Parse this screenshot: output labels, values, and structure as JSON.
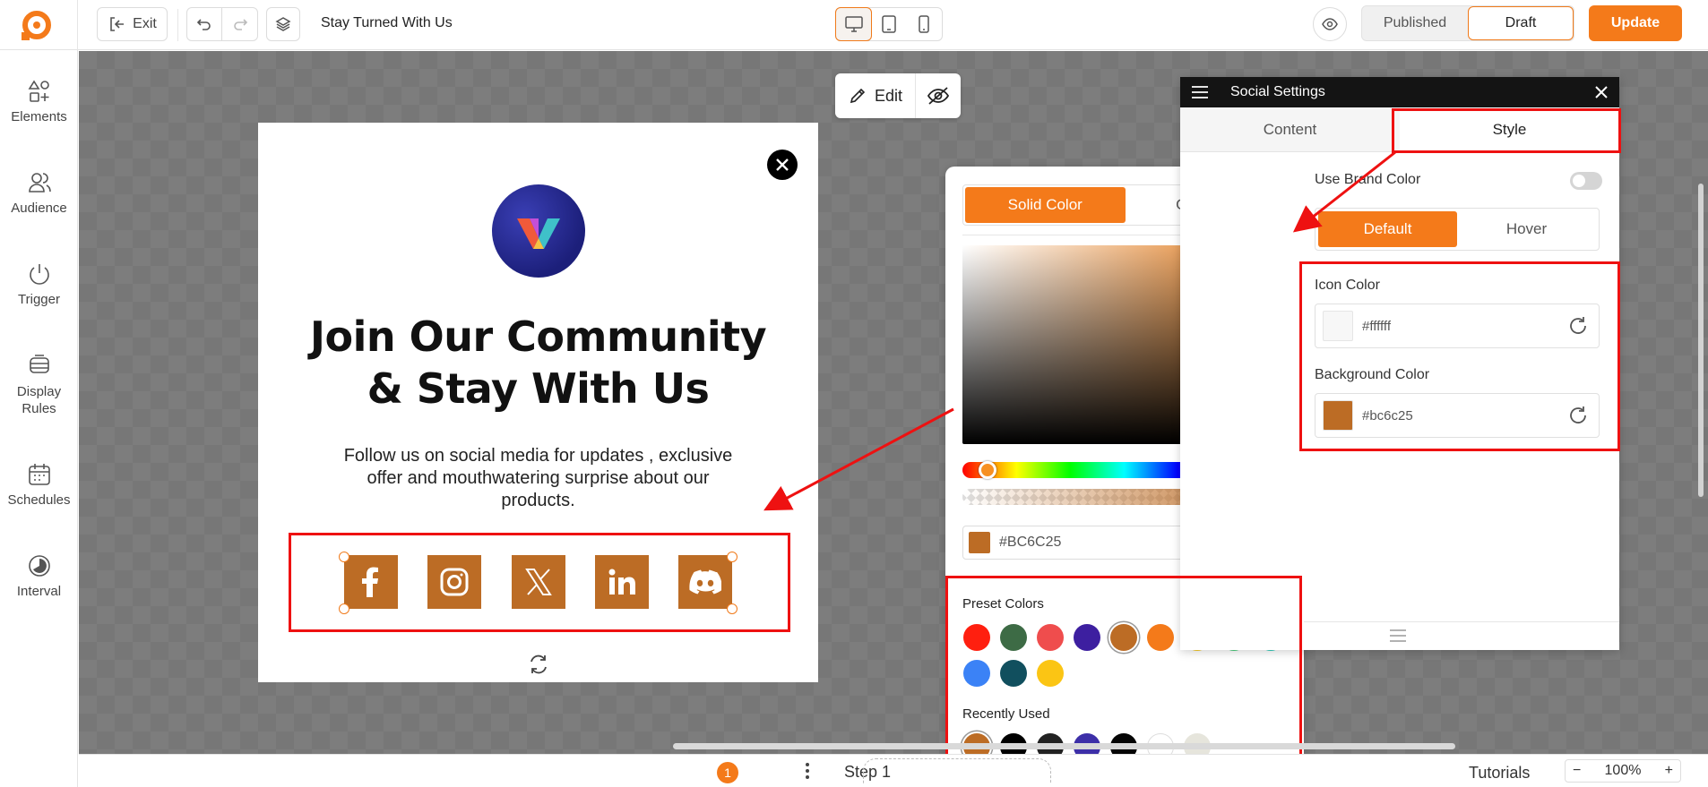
{
  "topbar": {
    "exit_label": "Exit",
    "document_title": "Stay Turned With Us",
    "published_label": "Published",
    "draft_label": "Draft",
    "update_label": "Update"
  },
  "sidebar": {
    "items": [
      {
        "label": "Elements",
        "icon": "elements-icon"
      },
      {
        "label": "Audience",
        "icon": "audience-icon"
      },
      {
        "label": "Trigger",
        "icon": "power-icon"
      },
      {
        "label": "Display Rules",
        "icon": "display-rules-icon"
      },
      {
        "label": "Schedules",
        "icon": "calendar-icon"
      },
      {
        "label": "Interval",
        "icon": "interval-icon"
      }
    ]
  },
  "canvas_toolbar": {
    "edit_label": "Edit"
  },
  "popup": {
    "headline_line1": "Join Our Community",
    "headline_line2": "& Stay With Us",
    "subtext": "Follow us on social media for updates , exclusive offer and mouthwatering surprise about our products.",
    "social_icons": [
      "facebook",
      "instagram",
      "x",
      "linkedin",
      "discord"
    ],
    "social_bg_color": "#bc6c25",
    "social_icon_color": "#ffffff"
  },
  "color_picker": {
    "tab_solid": "Solid Color",
    "tab_gradient": "Gradient",
    "hex_value": "#BC6C25",
    "preset_label": "Preset Colors",
    "preset_colors": [
      "#ff1f0f",
      "#3d6b45",
      "#ef4d4d",
      "#3d1fa0",
      "#bc6c25",
      "#f47a1a",
      "#fbcc21",
      "#48cf7b",
      "#2bcdbb",
      "#3b82f6",
      "#114f5e",
      "#fbc514"
    ],
    "recent_label": "Recently Used",
    "recent_colors": [
      "#bc6c25",
      "#000000",
      "#222222",
      "#3d2fa8",
      "#050505",
      "#ffffff",
      "#e6e5dc"
    ]
  },
  "settings_panel": {
    "title": "Social Settings",
    "tab_content": "Content",
    "tab_style": "Style",
    "use_brand_color_label": "Use Brand Color",
    "state_default": "Default",
    "state_hover": "Hover",
    "icon_color_label": "Icon Color",
    "icon_color_value": "#ffffff",
    "background_color_label": "Background Color",
    "background_color_value": "#bc6c25"
  },
  "bottombar": {
    "step_number": "1",
    "step_label": "Step 1",
    "tutorials_label": "Tutorials",
    "zoom_minus": "−",
    "zoom_value": "100%",
    "zoom_plus": "+"
  },
  "colors": {
    "accent": "#f47a1a",
    "annotation": "#e11111"
  }
}
